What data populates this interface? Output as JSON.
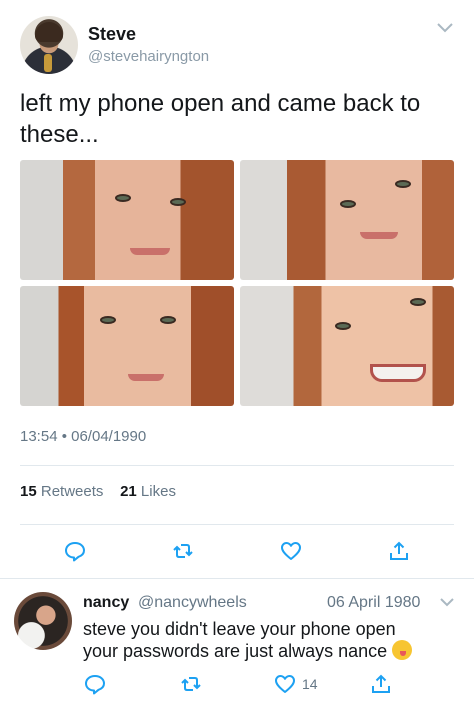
{
  "tweet": {
    "display_name": "Steve",
    "handle": "@stevehairyngton",
    "text": "left my phone open and came back to these...",
    "timestamp": "13:54 • 06/04/1990",
    "retweets_count": "15",
    "retweets_label": "Retweets",
    "likes_count": "21",
    "likes_label": "Likes"
  },
  "icons": {
    "reply": "reply-icon",
    "retweet": "retweet-icon",
    "like": "heart-icon",
    "share": "share-icon",
    "menu": "chevron-down-icon"
  },
  "reply": {
    "display_name": "nancy",
    "handle": "@nancywheels",
    "date": "06 April 1980",
    "line1": "steve you didn't leave your phone open",
    "line2": "your passwords are just always nance",
    "like_count": "14"
  },
  "colors": {
    "icon": "#1da1f2",
    "muted": "#657786",
    "divider": "#e1e8ed"
  }
}
